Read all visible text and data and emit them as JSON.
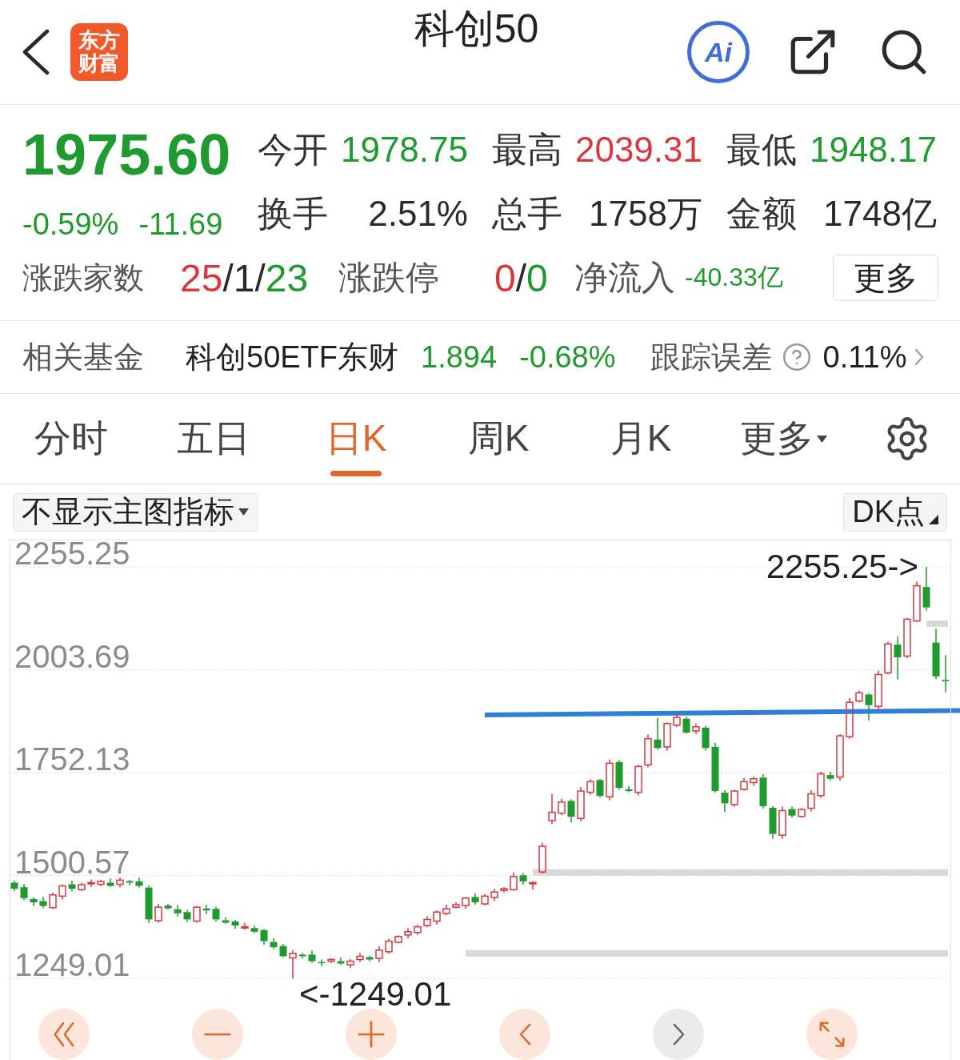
{
  "header": {
    "logo": "东方财富",
    "title": "科创50",
    "ai_label": "Ai"
  },
  "quote": {
    "price": "1975.60",
    "rising": false,
    "change_percent": "-0.59%",
    "change": "-11.69",
    "stats": [
      {
        "label": "今开",
        "value": "1978.75",
        "color": "#1f9a2e"
      },
      {
        "label": "最高",
        "value": "2039.31",
        "color": "#d8373c"
      },
      {
        "label": "最低",
        "value": "1948.17",
        "color": "#1f9a2e"
      },
      {
        "label": "换手",
        "value": "2.51%",
        "color": "#2a2a2a"
      },
      {
        "label": "总手",
        "value": "1758万",
        "color": "#2a2a2a"
      },
      {
        "label": "金额",
        "value": "1748亿",
        "color": "#2a2a2a"
      }
    ]
  },
  "breadth": {
    "items": [
      {
        "kind": "count",
        "label": "涨跌家数",
        "parts": [
          {
            "text": "25",
            "color": "#d8373c"
          },
          {
            "text": "/1/",
            "color": "#2a2a2a"
          },
          {
            "text": "23",
            "color": "#1f9a2e"
          }
        ]
      },
      {
        "kind": "count",
        "label": "涨跌停",
        "parts": [
          {
            "text": "0",
            "color": "#d8373c"
          },
          {
            "text": "/",
            "color": "#2a2a2a"
          },
          {
            "text": "0",
            "color": "#1f9a2e"
          }
        ]
      },
      {
        "kind": "flow",
        "label": "净流入",
        "parts": [
          {
            "text": "-40.33亿",
            "color": "#1f9a2e"
          }
        ]
      }
    ],
    "more_button": "更多"
  },
  "fund": {
    "label": "相关基金",
    "name": "科创50ETF东财",
    "price": "1.894",
    "price_rising": false,
    "change": "-0.68%",
    "change_rising": false,
    "tracking_label": "跟踪误差",
    "tracking_value": "0.11%"
  },
  "tabs": [
    {
      "label": "分时",
      "kind": "tab",
      "selected": false
    },
    {
      "label": "五日",
      "kind": "tab",
      "selected": false
    },
    {
      "label": "日K",
      "kind": "tab",
      "selected": true
    },
    {
      "label": "周K",
      "kind": "tab",
      "selected": false
    },
    {
      "label": "月K",
      "kind": "tab",
      "selected": false
    },
    {
      "label": "更多",
      "kind": "dropdown",
      "selected": false
    }
  ],
  "chart_toolbar": {
    "indicator_button": "不显示主图指标",
    "dk_button": "DK点"
  },
  "chart": {
    "chart_data": {
      "type": "candlestick",
      "ohlc": [
        [
          1483,
          1488,
          1462,
          1468
        ],
        [
          1472,
          1480,
          1441,
          1445
        ],
        [
          1443,
          1447,
          1426,
          1435
        ],
        [
          1438,
          1448,
          1421,
          1426
        ],
        [
          1422,
          1459,
          1419,
          1453
        ],
        [
          1450,
          1478,
          1442,
          1475
        ],
        [
          1479,
          1488,
          1462,
          1468
        ],
        [
          1466,
          1483,
          1462,
          1478
        ],
        [
          1481,
          1491,
          1472,
          1483
        ],
        [
          1479,
          1490,
          1474,
          1486
        ],
        [
          1483,
          1493,
          1472,
          1475
        ],
        [
          1479,
          1495,
          1471,
          1489
        ],
        [
          1487,
          1490,
          1477,
          1483
        ],
        [
          1486,
          1495,
          1471,
          1475
        ],
        [
          1471,
          1476,
          1384,
          1393
        ],
        [
          1390,
          1431,
          1385,
          1423
        ],
        [
          1427,
          1431,
          1417,
          1420
        ],
        [
          1418,
          1428,
          1400,
          1408
        ],
        [
          1411,
          1417,
          1387,
          1393
        ],
        [
          1389,
          1426,
          1385,
          1423
        ],
        [
          1420,
          1429,
          1406,
          1415
        ],
        [
          1419,
          1424,
          1388,
          1393
        ],
        [
          1391,
          1399,
          1382,
          1385
        ],
        [
          1388,
          1392,
          1370,
          1378
        ],
        [
          1374,
          1385,
          1368,
          1375
        ],
        [
          1372,
          1378,
          1359,
          1363
        ],
        [
          1367,
          1370,
          1331,
          1340
        ],
        [
          1338,
          1347,
          1320,
          1325
        ],
        [
          1328,
          1333,
          1300,
          1303
        ],
        [
          1299,
          1318,
          1249.01,
          1310
        ],
        [
          1307,
          1311,
          1297,
          1303
        ],
        [
          1307,
          1317,
          1287,
          1291
        ],
        [
          1289,
          1295,
          1279,
          1288
        ],
        [
          1291,
          1298,
          1286,
          1295
        ],
        [
          1291,
          1300,
          1282,
          1285
        ],
        [
          1282,
          1296,
          1274,
          1291
        ],
        [
          1295,
          1311,
          1289,
          1303
        ],
        [
          1301,
          1305,
          1291,
          1295
        ],
        [
          1298,
          1328,
          1289,
          1318
        ],
        [
          1314,
          1346,
          1309,
          1340
        ],
        [
          1337,
          1354,
          1334,
          1351
        ],
        [
          1355,
          1372,
          1347,
          1363
        ],
        [
          1361,
          1380,
          1355,
          1375
        ],
        [
          1378,
          1401,
          1374,
          1393
        ],
        [
          1389,
          1415,
          1380,
          1411
        ],
        [
          1408,
          1429,
          1403,
          1419
        ],
        [
          1423,
          1435,
          1420,
          1429
        ],
        [
          1427,
          1448,
          1419,
          1445
        ],
        [
          1448,
          1457,
          1429,
          1435
        ],
        [
          1431,
          1455,
          1427,
          1450
        ],
        [
          1447,
          1468,
          1438,
          1460
        ],
        [
          1464,
          1472,
          1459,
          1468
        ],
        [
          1466,
          1508,
          1463,
          1498
        ],
        [
          1501,
          1507,
          1478,
          1486
        ],
        [
          1482,
          1486,
          1466,
          1483
        ],
        [
          1509,
          1581,
          1505,
          1572
        ],
        [
          1635,
          1700,
          1626,
          1655
        ],
        [
          1653,
          1688,
          1648,
          1680
        ],
        [
          1683,
          1687,
          1630,
          1644
        ],
        [
          1640,
          1717,
          1632,
          1707
        ],
        [
          1704,
          1736,
          1698,
          1730
        ],
        [
          1734,
          1737,
          1691,
          1695
        ],
        [
          1693,
          1784,
          1684,
          1775
        ],
        [
          1778,
          1783,
          1710,
          1715
        ],
        [
          1711,
          1719,
          1704,
          1707
        ],
        [
          1704,
          1771,
          1696,
          1767
        ],
        [
          1771,
          1845,
          1765,
          1835
        ],
        [
          1833,
          1886,
          1808,
          1812
        ],
        [
          1815,
          1875,
          1806,
          1872
        ],
        [
          1868,
          1896,
          1863,
          1887
        ],
        [
          1884,
          1889,
          1847,
          1850
        ],
        [
          1854,
          1872,
          1846,
          1864
        ],
        [
          1862,
          1866,
          1806,
          1812
        ],
        [
          1815,
          1825,
          1703,
          1707
        ],
        [
          1703,
          1709,
          1655,
          1677
        ],
        [
          1674,
          1710,
          1669,
          1707
        ],
        [
          1711,
          1739,
          1708,
          1730
        ],
        [
          1728,
          1742,
          1720,
          1737
        ],
        [
          1740,
          1748,
          1664,
          1670
        ],
        [
          1666,
          1670,
          1590,
          1602
        ],
        [
          1599,
          1669,
          1590,
          1659
        ],
        [
          1663,
          1669,
          1642,
          1647
        ],
        [
          1645,
          1665,
          1642,
          1662
        ],
        [
          1665,
          1709,
          1657,
          1700
        ],
        [
          1696,
          1754,
          1690,
          1749
        ],
        [
          1746,
          1754,
          1733,
          1737
        ],
        [
          1741,
          1846,
          1732,
          1842
        ],
        [
          1840,
          1934,
          1835,
          1924
        ],
        [
          1927,
          1953,
          1924,
          1947
        ],
        [
          1943,
          1946,
          1880,
          1917
        ],
        [
          1914,
          2001,
          1908,
          1992
        ],
        [
          1996,
          2072,
          1992,
          2067
        ],
        [
          2065,
          2085,
          1980,
          2034
        ],
        [
          2037,
          2131,
          2032,
          2127
        ],
        [
          2123,
          2219,
          2120,
          2209
        ],
        [
          2206,
          2255.25,
          2148,
          2156
        ],
        [
          2070,
          2104,
          1981,
          1987.29
        ],
        [
          1978.75,
          2039.31,
          1948.17,
          1975.6
        ]
      ],
      "ylim": [
        1249.01,
        2255.25
      ],
      "yticks": [
        {
          "value": 2255.25,
          "label": "2255.25"
        },
        {
          "value": 2003.69,
          "label": "2003.69"
        },
        {
          "value": 1752.13,
          "label": "1752.13"
        },
        {
          "value": 1500.57,
          "label": "1500.57"
        },
        {
          "value": 1249.01,
          "label": "1249.01"
        }
      ],
      "grid": true,
      "annotations": [
        "2255.25->",
        "<-1249.01"
      ]
    }
  },
  "chart_controls": [
    {
      "kind": "rewind",
      "disabled": false
    },
    {
      "kind": "zoom_out",
      "disabled": false
    },
    {
      "kind": "zoom_in",
      "disabled": false
    },
    {
      "kind": "prev",
      "disabled": false
    },
    {
      "kind": "next",
      "disabled": true
    },
    {
      "kind": "fullscreen",
      "disabled": false
    }
  ]
}
